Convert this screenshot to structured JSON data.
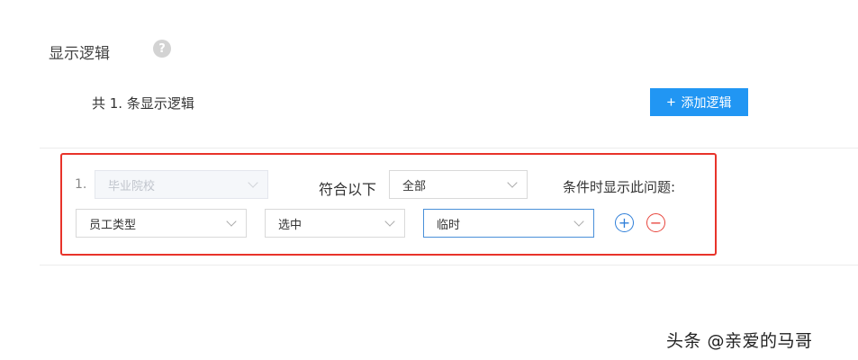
{
  "section": {
    "title": "显示逻辑",
    "help_icon": "?"
  },
  "summary": {
    "count_text": "共 1. 条显示逻辑"
  },
  "add_button": {
    "plus": "+",
    "label": "添加逻辑"
  },
  "rule": {
    "number": "1.",
    "question_select": {
      "value": "毕业院校"
    },
    "match_label": "符合以下",
    "match_select": {
      "value": "全部"
    },
    "suffix_label": "条件时显示此问题:",
    "condition": {
      "field_select": {
        "value": "员工类型"
      },
      "operator_select": {
        "value": "选中"
      },
      "value_select": {
        "value": "临时"
      }
    },
    "add_condition_icon": "+",
    "remove_condition_icon": "−"
  },
  "watermark": {
    "text": "头条 @亲爱的马哥"
  },
  "colors": {
    "accent": "#2196f3",
    "danger": "#e8332a"
  }
}
